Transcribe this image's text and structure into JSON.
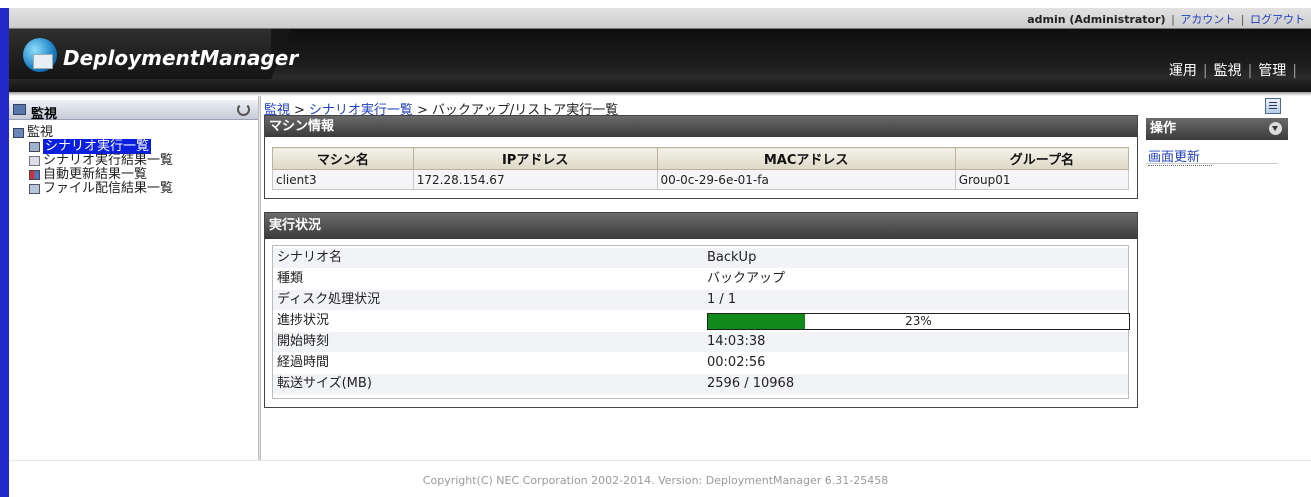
{
  "header": {
    "user": "admin (Administrator)",
    "account_link": "アカウント",
    "logout_link": "ログアウト",
    "logo_text": "DeploymentManager",
    "nav": [
      "運用",
      "監視",
      "管理"
    ]
  },
  "sidebar": {
    "title": "監視",
    "tree": {
      "root": "監視",
      "items": [
        "シナリオ実行一覧",
        "シナリオ実行結果一覧",
        "自動更新結果一覧",
        "ファイル配信結果一覧"
      ],
      "selected": "シナリオ実行一覧"
    }
  },
  "breadcrumb": {
    "crumbs": [
      "監視",
      "シナリオ実行一覧"
    ],
    "current": "バックアップ/リストア実行一覧",
    "separator": ">"
  },
  "machine_info": {
    "title": "マシン情報",
    "columns": [
      "マシン名",
      "IPアドレス",
      "MACアドレス",
      "グループ名"
    ],
    "row": [
      "client3",
      "172.28.154.67",
      "00-0c-29-6e-01-fa",
      "Group01"
    ]
  },
  "execution_status": {
    "title": "実行状況",
    "rows": [
      {
        "label": "シナリオ名",
        "value": "BackUp"
      },
      {
        "label": "種類",
        "value": "バックアップ"
      },
      {
        "label": "ディスク処理状況",
        "value": "1 / 1"
      },
      {
        "label": "進捗状況",
        "value": "23%"
      },
      {
        "label": "開始時刻",
        "value": "14:03:38"
      },
      {
        "label": "経過時間",
        "value": "00:02:56"
      },
      {
        "label": "転送サイズ(MB)",
        "value": "2596 / 10968"
      }
    ],
    "progress_fraction": 0.23
  },
  "operations": {
    "title": "操作",
    "refresh_link": "画面更新"
  },
  "footer": {
    "copyright": "Copyright(C) NEC Corporation 2002-2014. Version: DeploymentManager 6.31-25458"
  },
  "colors": {
    "accent_blue": "#2329c8",
    "progress_green": "#128a1b",
    "selected_bg": "#0a1fe0"
  }
}
